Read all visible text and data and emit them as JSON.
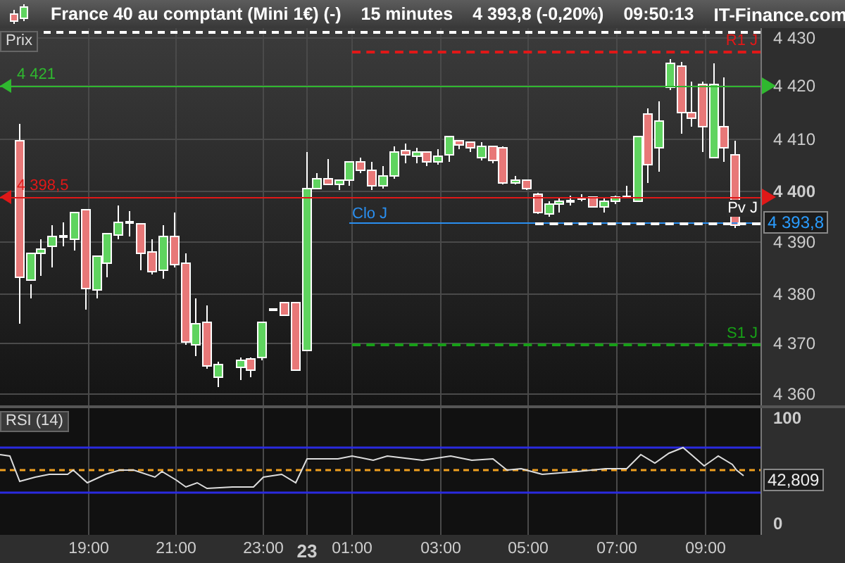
{
  "header": {
    "title": "France 40 au comptant (Mini 1€) (-)",
    "interval": "15 minutes",
    "quote": "4 393,8 (-0,20%)",
    "time": "09:50:13",
    "brand": "IT-Finance.com"
  },
  "price_panel": {
    "label": "Prix",
    "y_ticks": [
      {
        "label": "4 430",
        "emphasized": false
      },
      {
        "label": "4 420",
        "emphasized": false
      },
      {
        "label": "4 410",
        "emphasized": false
      },
      {
        "label": "4 400",
        "emphasized": true
      },
      {
        "label": "4 390",
        "emphasized": false
      },
      {
        "label": "4 380",
        "emphasized": false
      },
      {
        "label": "4 370",
        "emphasized": false
      },
      {
        "label": "4 360",
        "emphasized": false
      }
    ],
    "levels": [
      {
        "kind": "solid",
        "label": "4 421",
        "color": "#2fb82f"
      },
      {
        "kind": "solid",
        "label": "4 398,5",
        "color": "#e01818"
      },
      {
        "kind": "dashed",
        "label": "R1 J",
        "color": "#e01818"
      },
      {
        "kind": "start",
        "label": "Clo J",
        "color": "#2a8ff0"
      },
      {
        "kind": "dashed",
        "label": "Pv J",
        "color": "#ffffff"
      },
      {
        "kind": "dashed",
        "label": "S1 J",
        "color": "#17a017"
      }
    ],
    "current_price": "4 393,8"
  },
  "rsi_panel": {
    "label": "RSI (14)",
    "y_ticks": [
      {
        "label": "100",
        "emphasized": true
      },
      {
        "label": "0",
        "emphasized": true
      }
    ],
    "current_value": "42,809"
  },
  "time_axis": [
    {
      "label": "19:00",
      "emphasized": false
    },
    {
      "label": "21:00",
      "emphasized": false
    },
    {
      "label": "23:00",
      "emphasized": false
    },
    {
      "label": "23",
      "emphasized": true
    },
    {
      "label": "01:00",
      "emphasized": false
    },
    {
      "label": "03:00",
      "emphasized": false
    },
    {
      "label": "05:00",
      "emphasized": false
    },
    {
      "label": "07:00",
      "emphasized": false
    },
    {
      "label": "09:00",
      "emphasized": false
    }
  ]
}
